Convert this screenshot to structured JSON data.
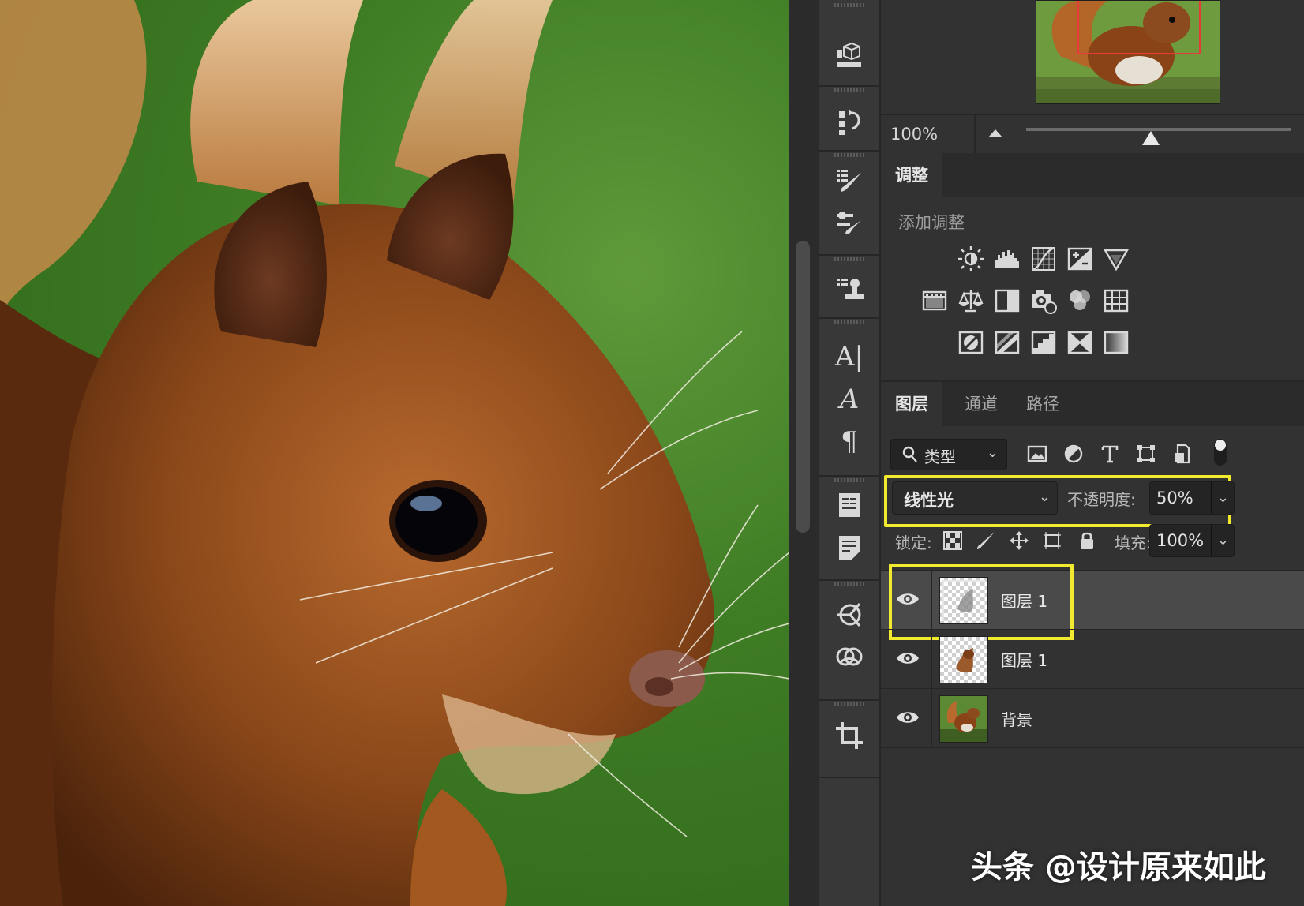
{
  "navigator": {
    "zoom": "100%",
    "zoom_slider_fraction": 0.47
  },
  "adjustments": {
    "tab": "调整",
    "subtitle": "添加调整",
    "row1": [
      "brightness-contrast-icon",
      "levels-icon",
      "curves-icon",
      "exposure-icon",
      "vibrance-icon"
    ],
    "row2": [
      "hue-saturation-icon",
      "color-balance-icon",
      "black-white-icon",
      "photo-filter-icon",
      "channel-mixer-icon",
      "color-lookup-icon"
    ],
    "row3": [
      "invert-icon",
      "posterize-icon",
      "threshold-icon",
      "selective-color-icon",
      "gradient-map-icon"
    ]
  },
  "layers_panel": {
    "tabs": [
      "图层",
      "通道",
      "路径"
    ],
    "filter": {
      "label": "类型"
    },
    "blend_mode": "线性光",
    "opacity_label": "不透明度:",
    "opacity": "50%",
    "lock_label": "锁定:",
    "fill_label": "填充:",
    "fill": "100%",
    "layers": [
      {
        "name": "图层 1",
        "visible": true,
        "selected": true
      },
      {
        "name": "图层 1",
        "visible": true,
        "selected": false
      },
      {
        "name": "背景",
        "visible": true,
        "selected": false
      }
    ]
  },
  "highlight_color": "#f1ea2e",
  "watermark": "头条 @设计原来如此"
}
